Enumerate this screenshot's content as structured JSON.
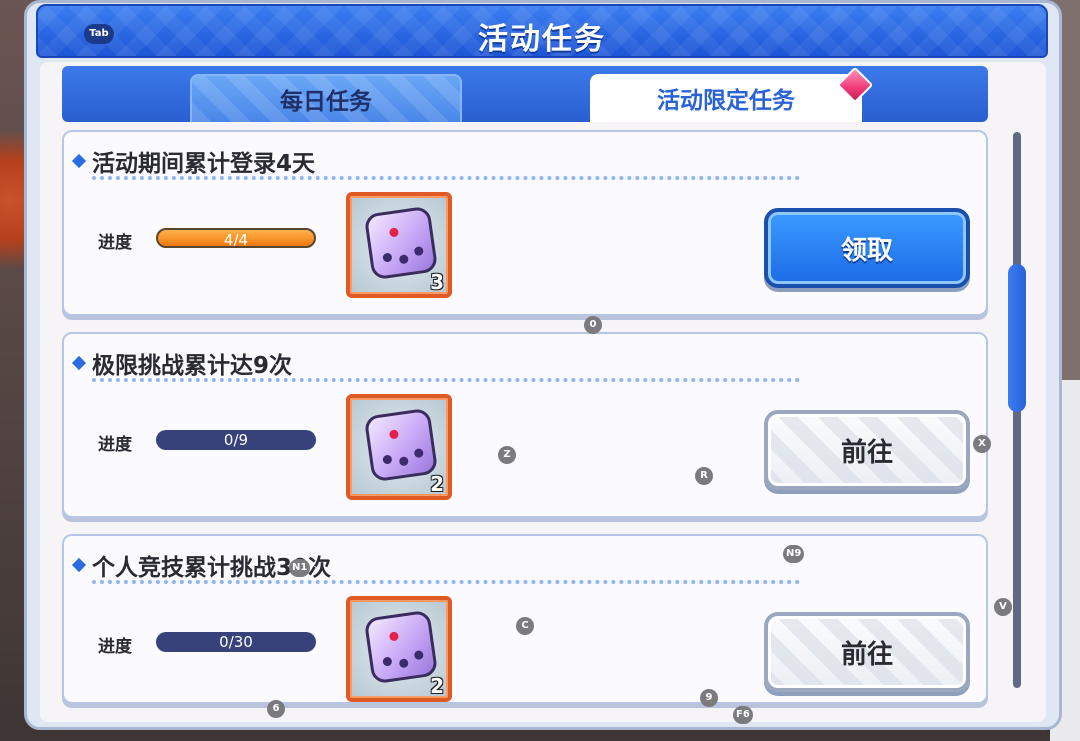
{
  "header": {
    "title": "活动任务",
    "tab_key": "Tab"
  },
  "tabs": [
    {
      "label": "每日任务",
      "active": false
    },
    {
      "label": "活动限定任务",
      "active": true
    }
  ],
  "tasks": [
    {
      "title": "活动期间累计登录4天",
      "progress_label": "进度",
      "progress_text": "4/4",
      "progress": 1.0,
      "reward_count": "3",
      "button_label": "领取",
      "button_type": "claim"
    },
    {
      "title": "极限挑战累计达9次",
      "progress_label": "进度",
      "progress_text": "0/9",
      "progress": 0.0,
      "reward_count": "2",
      "button_label": "前往",
      "button_type": "go"
    },
    {
      "title": "个人竞技累计挑战30次",
      "progress_label": "进度",
      "progress_text": "0/30",
      "progress": 0.0,
      "reward_count": "2",
      "button_label": "前往",
      "button_type": "go"
    }
  ],
  "hotkeys": [
    "0",
    "Z",
    "R",
    "X",
    "N9",
    "N1",
    "C",
    "V",
    "6",
    "9",
    "F6"
  ],
  "colors": {
    "accent_blue": "#2a63d6",
    "claim_button": "#1d6be6",
    "progress_fill": "#f07a10",
    "progress_track": "#37427a",
    "reward_border": "#e05a25"
  }
}
